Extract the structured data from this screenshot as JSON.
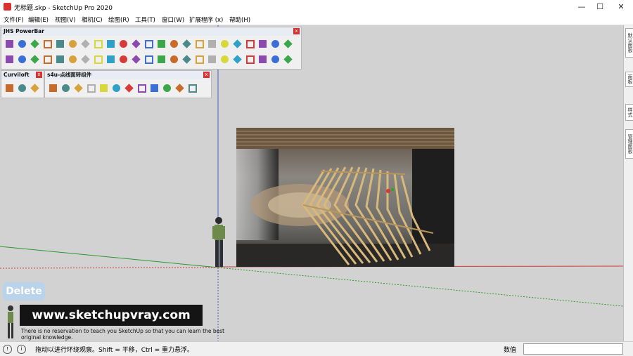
{
  "window": {
    "title": "无标题.skp - SketchUp Pro 2020",
    "minimize": "—",
    "maximize": "☐",
    "close": "✕"
  },
  "menu": [
    "文件(F)",
    "编辑(E)",
    "视图(V)",
    "相机(C)",
    "绘图(R)",
    "工具(T)",
    "窗口(W)",
    "扩展程序 (x)",
    "帮助(H)"
  ],
  "panels": {
    "powerbar": {
      "title": "JHS PowerBar",
      "close": "x"
    },
    "curviloft": {
      "title": "Curviloft",
      "close": "x"
    },
    "s4u": {
      "title": "s4u-点线面转组件",
      "close": "x"
    }
  },
  "overlay": {
    "delete_label": "Delete",
    "banner": "www.sketchupvray.com",
    "banner_sub": "There is no reservation to teach you SketchUp so that you can learn the best original knowledge."
  },
  "status": {
    "hint": "拖动以进行环绕观察。Shift = 平移，Ctrl = 重力悬浮。",
    "measure_label": "数值",
    "measure_value": ""
  },
  "right_tray_tabs": [
    "默认面板",
    "面板",
    "样式",
    "管理面板"
  ],
  "colors": {
    "accent": "#d9322e",
    "viewport": "#d2d2d2",
    "banner": "#141414",
    "delete": "#b9d3ea"
  }
}
